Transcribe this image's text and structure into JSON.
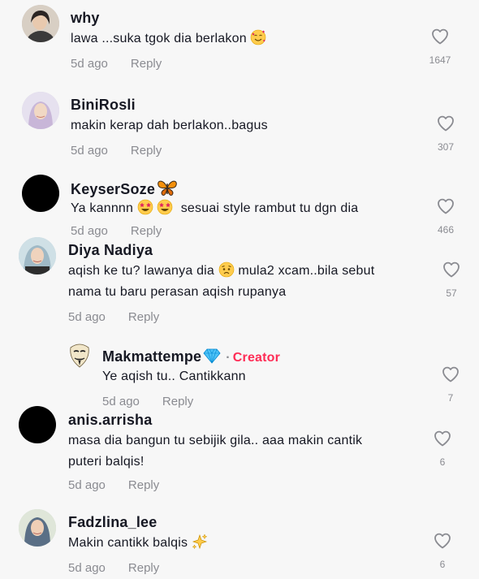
{
  "comments": [
    {
      "user": "why",
      "text": "lawa ...suka tgok dia berlakon",
      "emoji": "smiling-face-with-hearts",
      "age": "5d ago",
      "reply": "Reply",
      "likes": "1647"
    },
    {
      "user": "BiniRosli",
      "text": "makin kerap dah berlakon..bagus",
      "age": "5d ago",
      "reply": "Reply",
      "likes": "307"
    },
    {
      "user": "KeyserSoze",
      "user_badge": "butterfly",
      "text_prefix": "Ya kannnn",
      "text": "sesuai style rambut tu dgn dia",
      "emoji": "star-struck",
      "age": "5d ago",
      "reply": "Reply",
      "likes": "466"
    },
    {
      "user": "Diya Nadiya",
      "text_a": "aqish ke tu? lawanya dia",
      "emoji": "pleading-face",
      "text_b": "mula2 xcam..bila sebut",
      "text_line2": "nama tu baru perasan aqish rupanya",
      "age": "5d ago",
      "reply": "Reply",
      "likes": "57"
    },
    {
      "user": "Makmattempe",
      "user_badge": "gem",
      "creator_sep": "·",
      "creator_label": "Creator",
      "text": "Ye aqish tu.. Cantikkann",
      "age": "5d ago",
      "reply": "Reply",
      "likes": "7"
    },
    {
      "user": "anis.arrisha",
      "text_line1": "masa dia bangun tu sebijik gila.. aaa makin cantik",
      "text_line2": "puteri balqis!",
      "age": "5d ago",
      "reply": "Reply",
      "likes": "6"
    },
    {
      "user": "Fadzlina_lee",
      "text": "Makin cantikk balqis",
      "emoji": "sparkles",
      "age": "5d ago",
      "reply": "Reply",
      "likes": "6"
    }
  ],
  "colors": {
    "creator": "#fe2c55",
    "muted": "#8a8b91",
    "text": "#161823",
    "background": "#f7f7f7"
  }
}
